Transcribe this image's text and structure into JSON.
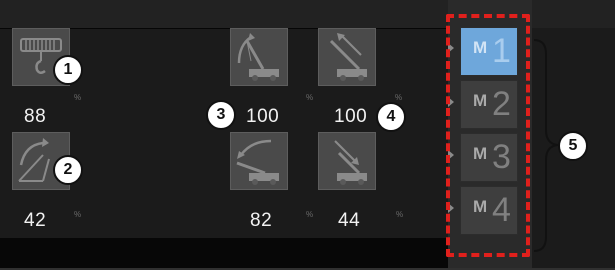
{
  "tiles": [
    {
      "name": "winch-hook",
      "icon": "winch-hook-icon",
      "value": "88",
      "unit": "%",
      "callout": "1"
    },
    {
      "name": "jib-raise",
      "icon": "jib-raise-icon",
      "value": "42",
      "unit": "%",
      "callout": "2"
    },
    {
      "name": "boom-raise",
      "icon": "boom-raise-icon",
      "value": "100",
      "unit": "%",
      "callout": "3"
    },
    {
      "name": "boom-lower",
      "icon": "boom-lower-icon",
      "value": "82",
      "unit": "%"
    },
    {
      "name": "telescope-extend",
      "icon": "telescope-extend-icon",
      "value": "100",
      "unit": "%",
      "callout": "4"
    },
    {
      "name": "telescope-retract",
      "icon": "telescope-retract-icon",
      "value": "44",
      "unit": "%"
    }
  ],
  "memory": {
    "callout": "5",
    "slots": [
      {
        "prefix": "M",
        "number": "1",
        "active": true
      },
      {
        "prefix": "M",
        "number": "2",
        "active": false
      },
      {
        "prefix": "M",
        "number": "3",
        "active": false
      },
      {
        "prefix": "M",
        "number": "4",
        "active": false
      }
    ]
  },
  "colors": {
    "active_slot": "#6ea7db",
    "highlight": "#e0201c",
    "tile_bg": "#4a4a4a"
  }
}
